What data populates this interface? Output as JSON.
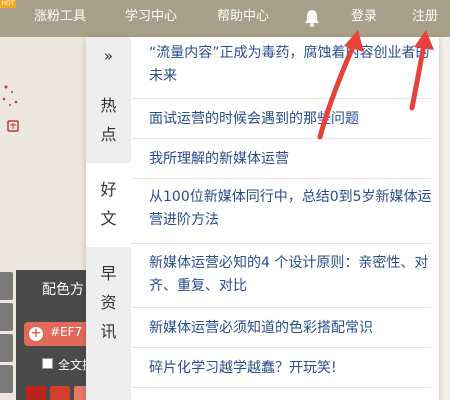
{
  "topbar": {
    "badge": "HOT",
    "nav": [
      {
        "label": "涨粉工具"
      },
      {
        "label": "学习中心"
      },
      {
        "label": "帮助中心"
      },
      {
        "label": "登录"
      },
      {
        "label": "注册"
      }
    ]
  },
  "panel": {
    "expand_glyph": "»",
    "tabs": [
      {
        "chars": [
          "热",
          "点"
        ]
      },
      {
        "chars": [
          "好",
          "文"
        ]
      },
      {
        "chars": [
          "早",
          "资",
          "讯"
        ]
      }
    ],
    "active_tab": 1,
    "articles": [
      "“流量内容”正成为毒药，腐蚀着内容创业者的未来",
      "面试运营的时候会遇到的那些问题",
      "我所理解的新媒体运营",
      "从100位新媒体同行中，总结0到5岁新媒体运营进阶方法",
      "新媒体运营必知的4 个设计原则：亲密性、对齐、重复、对比",
      "新媒体运营必须知道的色彩搭配常识",
      "碎片化学习越学越蠢？开玩笑!"
    ]
  },
  "color_panel": {
    "title": "配色方",
    "hex": "#EF7",
    "select_all": "全文换色"
  },
  "colors": {
    "topbar": "#a89f8a",
    "link": "#2a4d8f",
    "annotation_arrow": "#e8403a",
    "swatches": [
      "#b8241c",
      "#d0402e",
      "#e87a6a",
      "#fbe3dc"
    ]
  }
}
